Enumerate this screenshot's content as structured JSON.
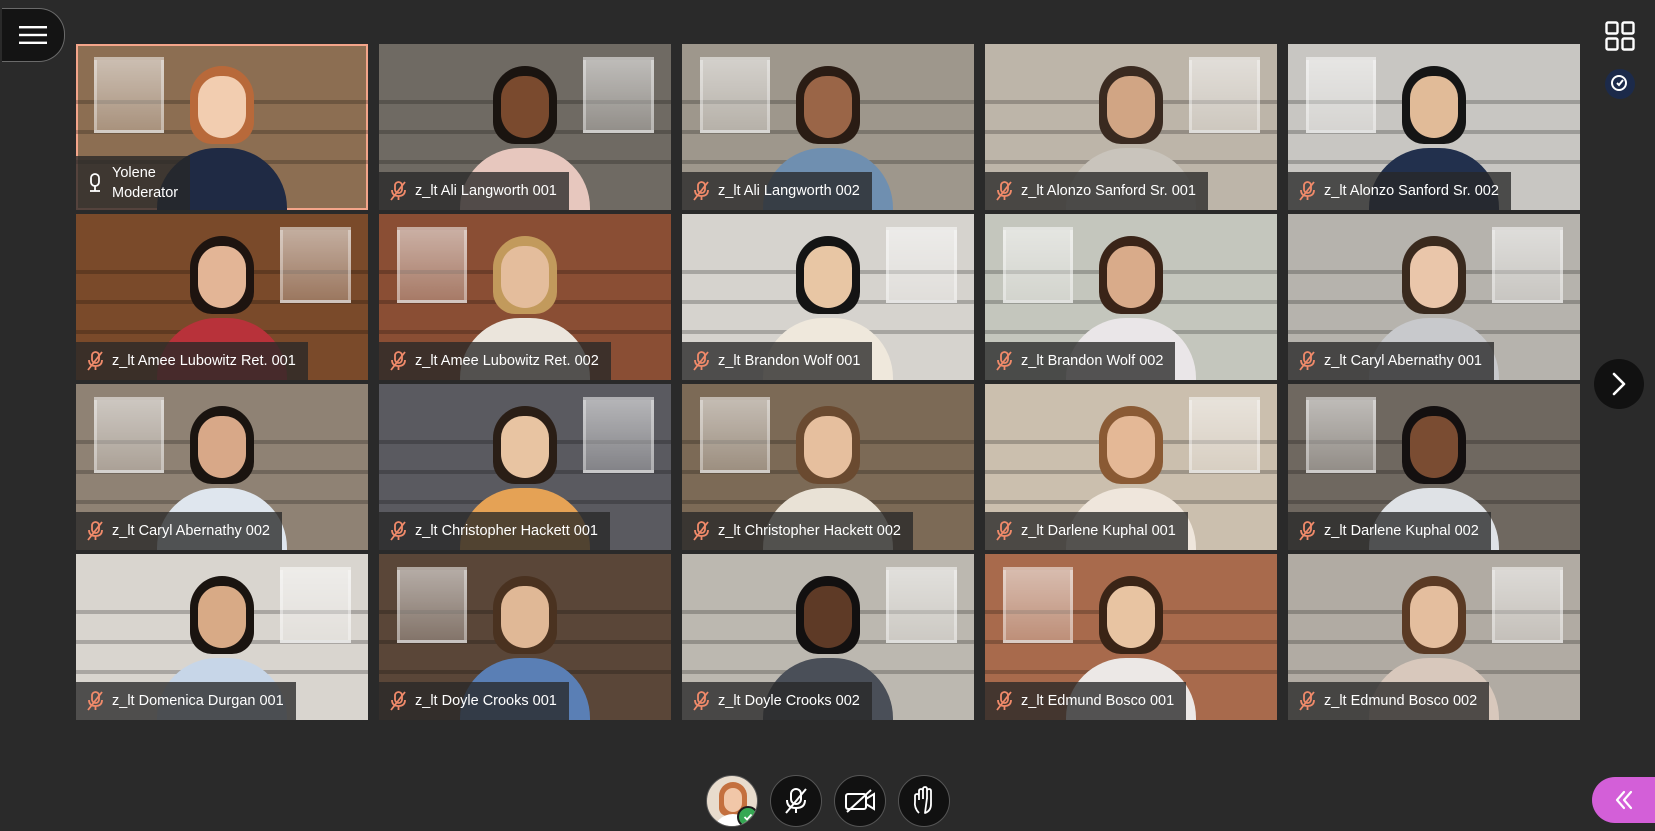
{
  "session": {
    "menu_icon": "hamburger-icon",
    "layout_icon": "grid-view-icon",
    "notifications_icon": "notification-icon",
    "next_page_icon": "chevron-right-icon"
  },
  "participants": [
    {
      "name": "Yolene",
      "role": "Moderator",
      "mic": "mic-on-icon",
      "skin": "#f2cdb0",
      "hair": "#b8693a",
      "shirt": "#1f2a44",
      "bg": "#8c6e52",
      "active": true
    },
    {
      "name": "z_lt Ali Langworth 001",
      "mic": "mic-muted-icon",
      "skin": "#7a4a2e",
      "hair": "#1a1410",
      "shirt": "#e7c7be",
      "bg": "#6f6a63"
    },
    {
      "name": "z_lt Ali Langworth 002",
      "mic": "mic-muted-icon",
      "skin": "#9a6547",
      "hair": "#2a1c14",
      "shirt": "#6f8fb0",
      "bg": "#9e978c"
    },
    {
      "name": "z_lt Alonzo Sanford Sr. 001",
      "mic": "mic-muted-icon",
      "skin": "#d1a584",
      "hair": "#3a2a20",
      "shirt": "#c9c4bc",
      "bg": "#bdb5a9"
    },
    {
      "name": "z_lt Alonzo Sanford Sr. 002",
      "mic": "mic-muted-icon",
      "skin": "#e1bb98",
      "hair": "#151515",
      "shirt": "#22304d",
      "bg": "#c8c6c2"
    },
    {
      "name": "z_lt Amee Lubowitz Ret. 001",
      "mic": "mic-muted-icon",
      "skin": "#e3b596",
      "hair": "#1e1410",
      "shirt": "#b8323a",
      "bg": "#7a4a2a"
    },
    {
      "name": "z_lt Amee Lubowitz Ret. 002",
      "mic": "mic-muted-icon",
      "skin": "#e4bd9c",
      "hair": "#c29a5c",
      "shirt": "#ebe5dc",
      "bg": "#8a4e34"
    },
    {
      "name": "z_lt Brandon Wolf 001",
      "mic": "mic-muted-icon",
      "skin": "#e8c6a4",
      "hair": "#141414",
      "shirt": "#efe8dc",
      "bg": "#d6d3ce"
    },
    {
      "name": "z_lt Brandon Wolf 002",
      "mic": "mic-muted-icon",
      "skin": "#d9ab8a",
      "hair": "#3a2418",
      "shirt": "#eae6e8",
      "bg": "#c4c6bd"
    },
    {
      "name": "z_lt Caryl Abernathy 001",
      "mic": "mic-muted-icon",
      "skin": "#eac6aa",
      "hair": "#3a2a1e",
      "shirt": "#c8c9cc",
      "bg": "#b6b3ad"
    },
    {
      "name": "z_lt Caryl Abernathy 002",
      "mic": "mic-muted-icon",
      "skin": "#d8a888",
      "hair": "#1a1410",
      "shirt": "#dfe6ee",
      "bg": "#8f8274"
    },
    {
      "name": "z_lt Christopher Hackett 001",
      "mic": "mic-muted-icon",
      "skin": "#e8c4a2",
      "hair": "#2a1e16",
      "shirt": "#e5a255",
      "bg": "#5a5a60"
    },
    {
      "name": "z_lt Christopher Hackett 002",
      "mic": "mic-muted-icon",
      "skin": "#e6bf9e",
      "hair": "#6a4a30",
      "shirt": "#e9e2d6",
      "bg": "#7c6a56"
    },
    {
      "name": "z_lt Darlene Kuphal 001",
      "mic": "mic-muted-icon",
      "skin": "#e4b896",
      "hair": "#8a5a34",
      "shirt": "#efe6dc",
      "bg": "#cbbfae"
    },
    {
      "name": "z_lt Darlene Kuphal 002",
      "mic": "mic-muted-icon",
      "skin": "#7a4c32",
      "hair": "#141010",
      "shirt": "#dfe2e6",
      "bg": "#6f6860"
    },
    {
      "name": "z_lt Domenica Durgan 001",
      "mic": "mic-muted-icon",
      "skin": "#d8aa86",
      "hair": "#1a1410",
      "shirt": "#c7d6e8",
      "bg": "#d9d5cf"
    },
    {
      "name": "z_lt Doyle Crooks 001",
      "mic": "mic-muted-icon",
      "skin": "#e0b896",
      "hair": "#4a3220",
      "shirt": "#5a7fb5",
      "bg": "#5a4638"
    },
    {
      "name": "z_lt Doyle Crooks 002",
      "mic": "mic-muted-icon",
      "skin": "#5e3a26",
      "hair": "#121010",
      "shirt": "#4a4f58",
      "bg": "#bcb8b0"
    },
    {
      "name": "z_lt Edmund Bosco 001",
      "mic": "mic-muted-icon",
      "skin": "#e8c4a2",
      "hair": "#3a2416",
      "shirt": "#ece8e6",
      "bg": "#a86a4c"
    },
    {
      "name": "z_lt Edmund Bosco 002",
      "mic": "mic-muted-icon",
      "skin": "#e4be9e",
      "hair": "#5a3a24",
      "shirt": "#d8c8bc",
      "bg": "#b1aba3"
    }
  ],
  "controls": {
    "avatar_icon": "user-avatar-icon",
    "status_icon": "check-icon",
    "mic_icon": "mic-muted-icon",
    "camera_icon": "camera-off-icon",
    "hand_icon": "raise-hand-icon"
  },
  "collaborate_panel": {
    "icon": "double-chevron-left-icon",
    "color": "#d35fd8"
  },
  "colors": {
    "background": "#2a2a2a",
    "active_border": "#f4a58a",
    "muted_icon": "#f08a6a"
  }
}
